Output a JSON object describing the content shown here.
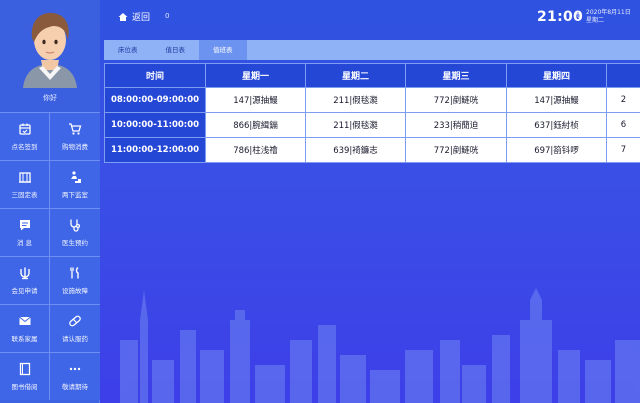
{
  "profile": {
    "greeting": "你好"
  },
  "sidebar": {
    "items": [
      {
        "label": "点名签到",
        "icon": "calendar-check-icon"
      },
      {
        "label": "购物消费",
        "icon": "cart-icon"
      },
      {
        "label": "三固定表",
        "icon": "building-icon"
      },
      {
        "label": "两下监室",
        "icon": "person-stairs-icon"
      },
      {
        "label": "消 息",
        "icon": "message-icon"
      },
      {
        "label": "医生预约",
        "icon": "stethoscope-icon"
      },
      {
        "label": "会见申请",
        "icon": "meeting-icon"
      },
      {
        "label": "设施故障",
        "icon": "tools-icon"
      },
      {
        "label": "联系家属",
        "icon": "mail-icon"
      },
      {
        "label": "请认服药",
        "icon": "pill-icon"
      },
      {
        "label": "图书借阅",
        "icon": "book-icon"
      },
      {
        "label": "敬请期待",
        "icon": "more-icon"
      }
    ]
  },
  "header": {
    "back_label": "返回",
    "back_count": "0",
    "time": "21:00",
    "date": "2020年8月11日",
    "weekday": "星期二"
  },
  "tabs": [
    {
      "label": "床位表",
      "active": false
    },
    {
      "label": "值日表",
      "active": false
    },
    {
      "label": "值班表",
      "active": true
    }
  ],
  "table": {
    "headers": [
      "时间",
      "星期一",
      "星期二",
      "星期三",
      "星期四",
      ""
    ],
    "rows": [
      {
        "time": "08:00:00-09:00:00",
        "cells": [
          "147|源抽鰻",
          "211|假毯㶋",
          "772|剷鲢咣",
          "147|源抽鰻",
          "2"
        ]
      },
      {
        "time": "10:00:00-11:00:00",
        "cells": [
          "866|腕緝鏰",
          "211|假毯㶋",
          "233|稍蕑迫",
          "637|鈺紂桢",
          "6"
        ]
      },
      {
        "time": "11:00:00-12:00:00",
        "cells": [
          "786|柱浅禬",
          "639|裿鐮志",
          "772|剷鲢咣",
          "697|箚钭啰",
          "7"
        ]
      }
    ]
  },
  "colors": {
    "background": "#3a4fe6",
    "header_cell": "#2547d6",
    "tab_bar": "#8fb1f6",
    "tab_active": "#6d93f0"
  }
}
